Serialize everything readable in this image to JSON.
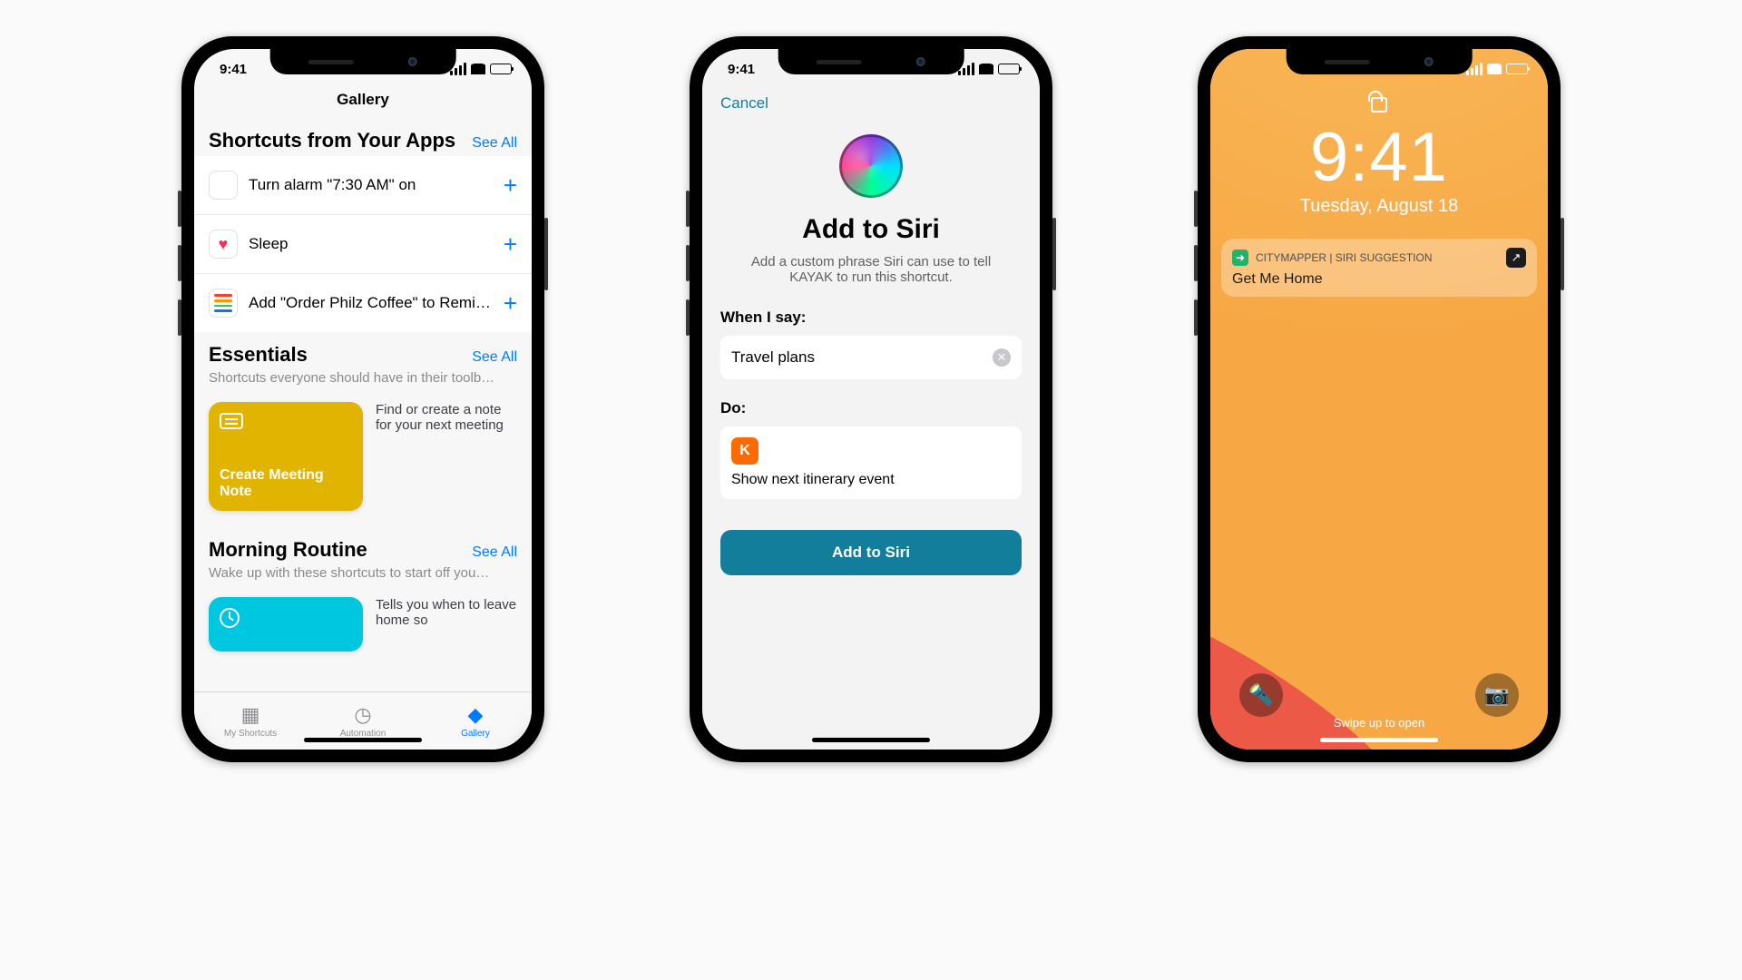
{
  "status": {
    "time": "9:41"
  },
  "phone1": {
    "nav_title": "Gallery",
    "sections": {
      "from_apps": {
        "title": "Shortcuts from Your Apps",
        "see_all": "See All",
        "rows": [
          {
            "icon": "clock-app-icon",
            "label": "Turn alarm \"7:30 AM\" on"
          },
          {
            "icon": "health-heart-icon",
            "label": "Sleep"
          },
          {
            "icon": "reminders-app-icon",
            "label": "Add \"Order Philz Coffee\" to Remin…"
          }
        ]
      },
      "essentials": {
        "title": "Essentials",
        "subtitle": "Shortcuts everyone should have in their toolb…",
        "see_all": "See All",
        "tile_title": "Create Meeting Note",
        "tile_desc": "Find or create a note for your next meeting"
      },
      "morning": {
        "title": "Morning Routine",
        "subtitle": "Wake up with these shortcuts to start off you…",
        "see_all": "See All",
        "tile_desc": "Tells you when to leave home so"
      }
    },
    "tabs": {
      "my_shortcuts": "My Shortcuts",
      "automation": "Automation",
      "gallery": "Gallery"
    },
    "glyphs": {
      "plus": "+"
    }
  },
  "phone2": {
    "cancel": "Cancel",
    "title": "Add to Siri",
    "subtitle": "Add a custom phrase Siri can use to tell KAYAK to run this shortcut.",
    "when_label": "When I say:",
    "when_value": "Travel plans",
    "do_label": "Do:",
    "do_app_letter": "K",
    "do_value": "Show next itinerary event",
    "cta": "Add to Siri"
  },
  "phone3": {
    "time": "9:41",
    "date": "Tuesday, August 18",
    "notif": {
      "app_source": "CITYMAPPER | SIRI SUGGESTION",
      "title": "Get Me Home"
    },
    "swipe": "Swipe up to open"
  }
}
